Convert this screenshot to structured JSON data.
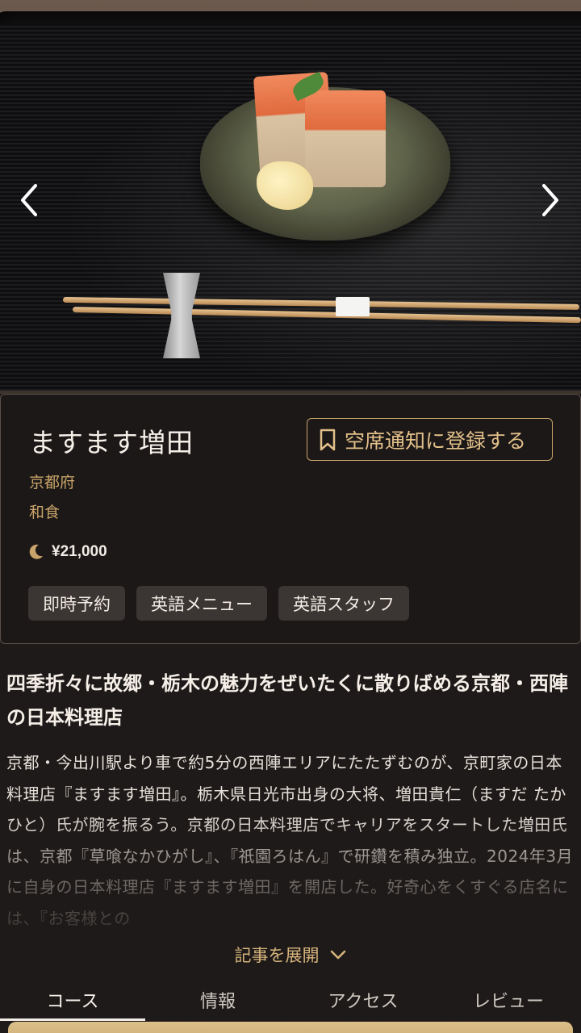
{
  "restaurant": {
    "name": "ますます増田",
    "prefecture": "京都府",
    "genre": "和食",
    "price": "¥21,000",
    "price_icon": "moon-icon"
  },
  "notify_button": {
    "label": "空席通知に登録する",
    "icon": "bookmark-icon"
  },
  "tags": [
    "即時予約",
    "英語メニュー",
    "英語スタッフ"
  ],
  "article": {
    "headline": "四季折々に故郷・栃木の魅力をぜいたくに散りばめる京都・西陣の日本料理店",
    "body": "京都・今出川駅より車で約5分の西陣エリアにたたずむのが、京町家の日本料理店『ますます増田』。栃木県日光市出身の大将、増田貴仁（ますだ たかひと）氏が腕を振るう。京都の日本料理店でキャリアをスタートした増田氏は、京都『草喰なかひがし』、『祇園ろはん』で研鑽を積み独立。2024年3月に自身の日本料理店『ますます増田』を開店した。好奇心をくすぐる店名には、『お客様との",
    "expand_label": "記事を展開"
  },
  "tabs": [
    {
      "label": "コース",
      "active": true
    },
    {
      "label": "情報",
      "active": false
    },
    {
      "label": "アクセス",
      "active": false
    },
    {
      "label": "レビュー",
      "active": false
    }
  ],
  "colors": {
    "accent": "#c8a46a",
    "background": "#1e1a19",
    "card": "#1c1817",
    "tag": "#3b3533"
  }
}
